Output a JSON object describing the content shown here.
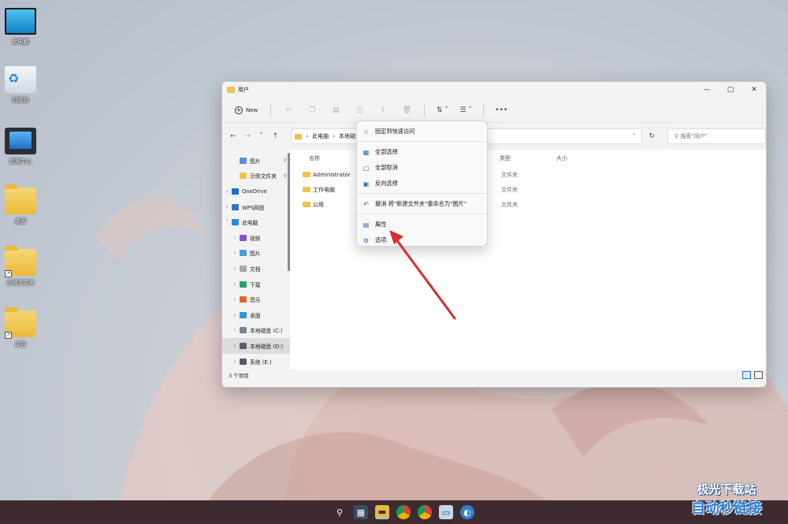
{
  "desktop": {
    "icons": [
      {
        "label": "此电脑",
        "kind": "monitor"
      },
      {
        "label": "回收站",
        "kind": "recycle"
      },
      {
        "label": "应用中心",
        "kind": "app"
      },
      {
        "label": "桌面",
        "kind": "folder"
      },
      {
        "label": "示例文件夹",
        "kind": "folder-shortcut"
      },
      {
        "label": "文档",
        "kind": "folder-shortcut"
      }
    ]
  },
  "window": {
    "title": "用户",
    "toolbar": {
      "new_label": "New"
    },
    "breadcrumb": [
      "此电脑",
      "本地磁盘"
    ],
    "search_placeholder": "搜索\"用户\"",
    "columns": {
      "name": "名称",
      "type": "类型",
      "size": "大小"
    },
    "files": [
      {
        "name": "Administrator",
        "type": "文件夹"
      },
      {
        "name": "工作电脑",
        "type": "文件夹"
      },
      {
        "name": "公用",
        "type": "文件夹"
      }
    ],
    "sidebar": [
      {
        "label": "图片",
        "icon": "pictures-icon",
        "pinned": true,
        "indent": true,
        "color": "#5b8fd6"
      },
      {
        "label": "示例文件夹",
        "icon": "folder-icon",
        "pinned": true,
        "indent": true,
        "color": "#f0c24a"
      },
      {
        "label": "OneDrive",
        "icon": "cloud-icon",
        "chevron": true,
        "color": "#1a6cd1"
      },
      {
        "label": "WPS网盘",
        "icon": "cloud-icon",
        "chevron": true,
        "color": "#3a6fc8"
      },
      {
        "label": "此电脑",
        "icon": "computer-icon",
        "chevron": true,
        "expanded": true,
        "color": "#2a8ad8"
      },
      {
        "label": "视频",
        "icon": "video-icon",
        "chevron": true,
        "indent": true,
        "color": "#8c4fd1"
      },
      {
        "label": "图片",
        "icon": "pictures-icon",
        "chevron": true,
        "indent": true,
        "color": "#4b9be0"
      },
      {
        "label": "文档",
        "icon": "documents-icon",
        "chevron": true,
        "indent": true,
        "color": "#a3aab3"
      },
      {
        "label": "下载",
        "icon": "download-icon",
        "chevron": true,
        "indent": true,
        "color": "#2aa36a"
      },
      {
        "label": "音乐",
        "icon": "music-icon",
        "chevron": true,
        "indent": true,
        "color": "#e0672c"
      },
      {
        "label": "桌面",
        "icon": "desktop-icon",
        "chevron": true,
        "indent": true,
        "color": "#2d9ad8"
      },
      {
        "label": "本地磁盘 (C:)",
        "icon": "drive-icon",
        "chevron": true,
        "indent": true,
        "color": "#7a8491"
      },
      {
        "label": "本地磁盘 (D:)",
        "icon": "drive-icon",
        "chevron": true,
        "indent": true,
        "selected": true,
        "color": "#555d68"
      },
      {
        "label": "系统 (E:)",
        "icon": "drive-icon",
        "chevron": true,
        "indent": true,
        "color": "#555d68"
      }
    ],
    "status": "3 个项目"
  },
  "context_menu": {
    "groups": [
      [
        {
          "label": "固定到快速访问",
          "icon": "star-icon"
        }
      ],
      [
        {
          "label": "全部选择",
          "icon": "select-all-icon"
        },
        {
          "label": "全部取消",
          "icon": "select-none-icon"
        },
        {
          "label": "反向选择",
          "icon": "invert-selection-icon"
        }
      ],
      [
        {
          "label": "撤消 将\"新建文件夹\"重命名为\"图片\"",
          "icon": "undo-icon"
        }
      ],
      [
        {
          "label": "属性",
          "icon": "properties-icon"
        },
        {
          "label": "选项",
          "icon": "options-icon"
        }
      ]
    ]
  },
  "taskbar": {
    "items": [
      "start-icon",
      "search-icon",
      "widgets-icon",
      "file-explorer-icon",
      "chrome-icon",
      "chrome-icon",
      "remote-desktop-icon",
      "browser-icon"
    ]
  },
  "watermark": {
    "line1": "极光下载站",
    "line2": "自动秒链接"
  },
  "colors": {
    "accent": "#1a6cd1",
    "annotation_arrow": "#d62d2d"
  }
}
